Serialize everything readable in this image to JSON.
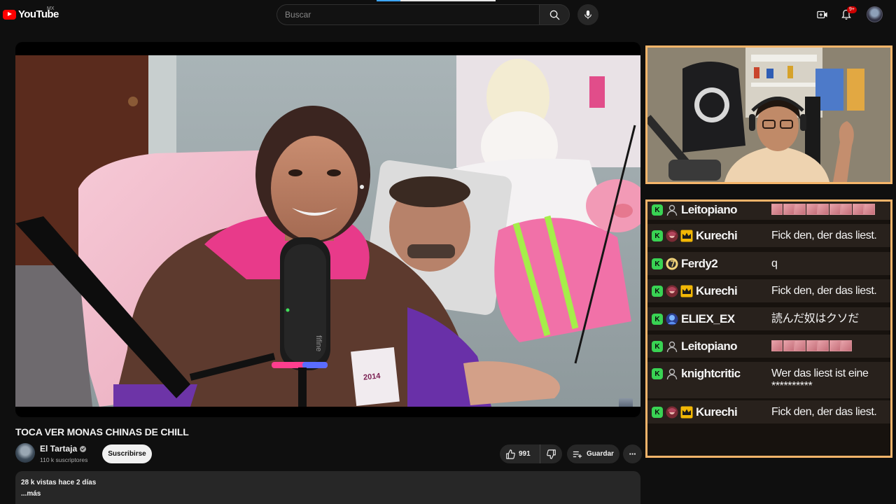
{
  "header": {
    "logo_text": "YouTube",
    "country_code": "MX",
    "search_placeholder": "Buscar",
    "notification_count": "9+"
  },
  "video": {
    "title": "TOCA VER MONAS CHINAS DE CHILL",
    "mic_brand": "fifine",
    "sweater_year": "2014"
  },
  "channel": {
    "name": "El Tartaja",
    "subscribers": "110 k suscriptores",
    "subscribe_label": "Suscribirse"
  },
  "actions": {
    "like_count": "991",
    "save_label": "Guardar"
  },
  "description": {
    "meta": "28 k vistas  hace 2 días",
    "more_label": "...más"
  },
  "chat": {
    "messages": [
      {
        "user": "Leitopiano",
        "text": "",
        "emotes": 9,
        "crown": false,
        "icon": "person"
      },
      {
        "user": "Kurechi",
        "text": "Fick den, der das liest.",
        "crown": true,
        "icon": "anime"
      },
      {
        "user": "Ferdy2",
        "text": "q",
        "crown": false,
        "icon": "gold"
      },
      {
        "user": "Kurechi",
        "text": "Fick den, der das liest.",
        "crown": true,
        "icon": "anime"
      },
      {
        "user": "ELIEX_EX",
        "text": "読んだ奴はクソだ",
        "crown": false,
        "icon": "blue"
      },
      {
        "user": "Leitopiano",
        "text": "",
        "emotes": 7,
        "crown": false,
        "icon": "person"
      },
      {
        "user": "knightcritic",
        "text": "Wer das liest ist eine **********",
        "crown": false,
        "icon": "person"
      },
      {
        "user": "Kurechi",
        "text": "Fick den, der das liest.",
        "crown": true,
        "icon": "anime"
      }
    ]
  },
  "colors": {
    "youtube_red": "#ff0000",
    "kick_green": "#39d353",
    "overlay_border": "#f5b56a",
    "crown_gold": "#f2b705"
  }
}
